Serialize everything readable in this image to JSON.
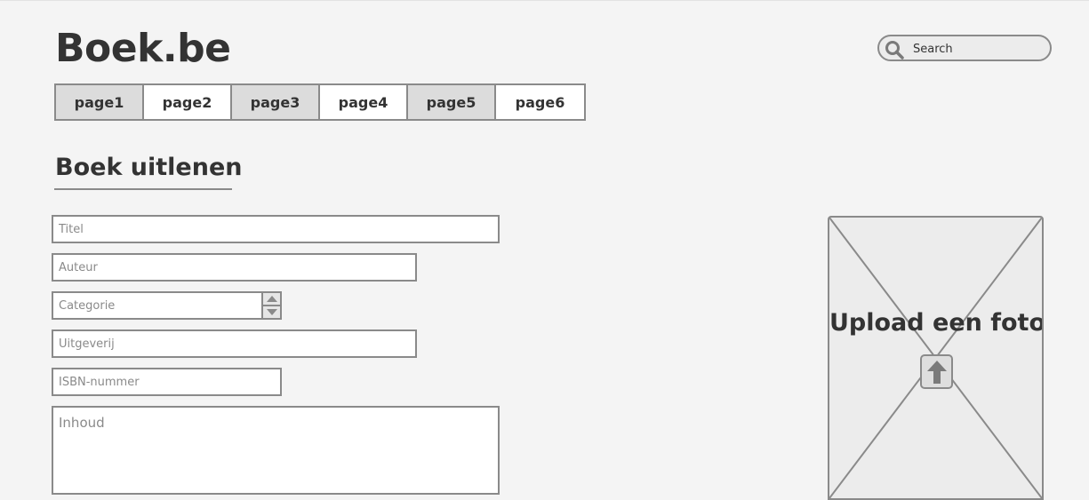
{
  "header": {
    "logo": "Boek.be",
    "search": {
      "placeholder": "Search",
      "icon": "search-icon"
    }
  },
  "nav": {
    "tabs": [
      {
        "label": "page1"
      },
      {
        "label": "page2"
      },
      {
        "label": "page3"
      },
      {
        "label": "page4"
      },
      {
        "label": "page5"
      },
      {
        "label": "page6"
      }
    ]
  },
  "form": {
    "title": "Boek uitlenen",
    "fields": {
      "titel": {
        "placeholder": "Titel"
      },
      "auteur": {
        "placeholder": "Auteur"
      },
      "categorie": {
        "placeholder": "Categorie"
      },
      "uitgeverij": {
        "placeholder": "Uitgeverij"
      },
      "isbn": {
        "placeholder": "ISBN-nummer"
      },
      "inhoud": {
        "placeholder": "Inhoud"
      }
    }
  },
  "upload": {
    "label": "Upload een foto",
    "icon": "upload-arrow-icon"
  },
  "colors": {
    "background": "#f4f4f4",
    "border": "#8a8a8a",
    "text": "#333333",
    "shaded_tab": "#dcdcdc"
  }
}
